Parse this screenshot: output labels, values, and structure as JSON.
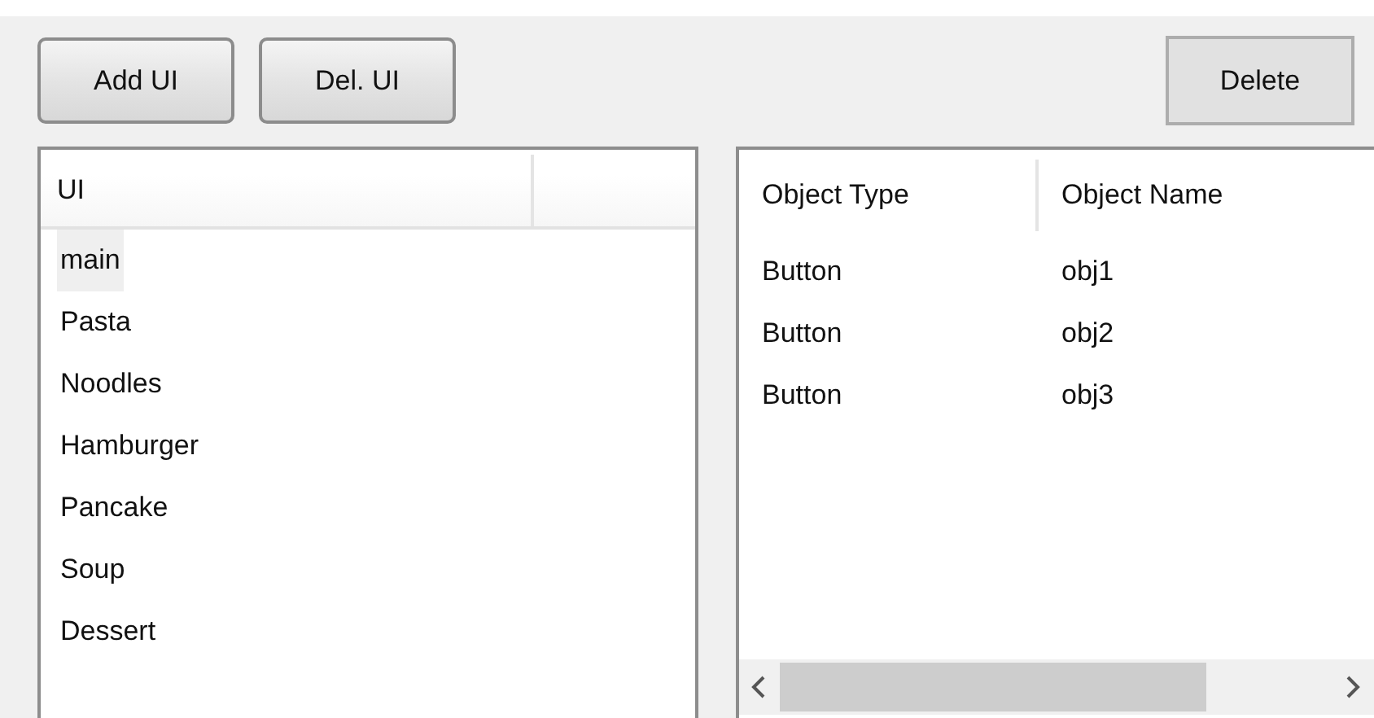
{
  "toolbar": {
    "buttons": [
      {
        "label": "Add UI"
      },
      {
        "label": "Del. UI"
      }
    ],
    "delete_button": {
      "label": "Delete"
    }
  },
  "ui_list": {
    "columns": [
      "UI"
    ],
    "items": [
      {
        "label": "main",
        "selected": true
      },
      {
        "label": "Pasta",
        "selected": false
      },
      {
        "label": "Noodles",
        "selected": false
      },
      {
        "label": "Hamburger",
        "selected": false
      },
      {
        "label": "Pancake",
        "selected": false
      },
      {
        "label": "Soup",
        "selected": false
      },
      {
        "label": "Dessert",
        "selected": false
      }
    ]
  },
  "object_table": {
    "columns": [
      "Object Type",
      "Object Name"
    ],
    "rows": [
      [
        "Button",
        "obj1"
      ],
      [
        "Button",
        "obj2"
      ],
      [
        "Button",
        "obj3"
      ]
    ]
  }
}
